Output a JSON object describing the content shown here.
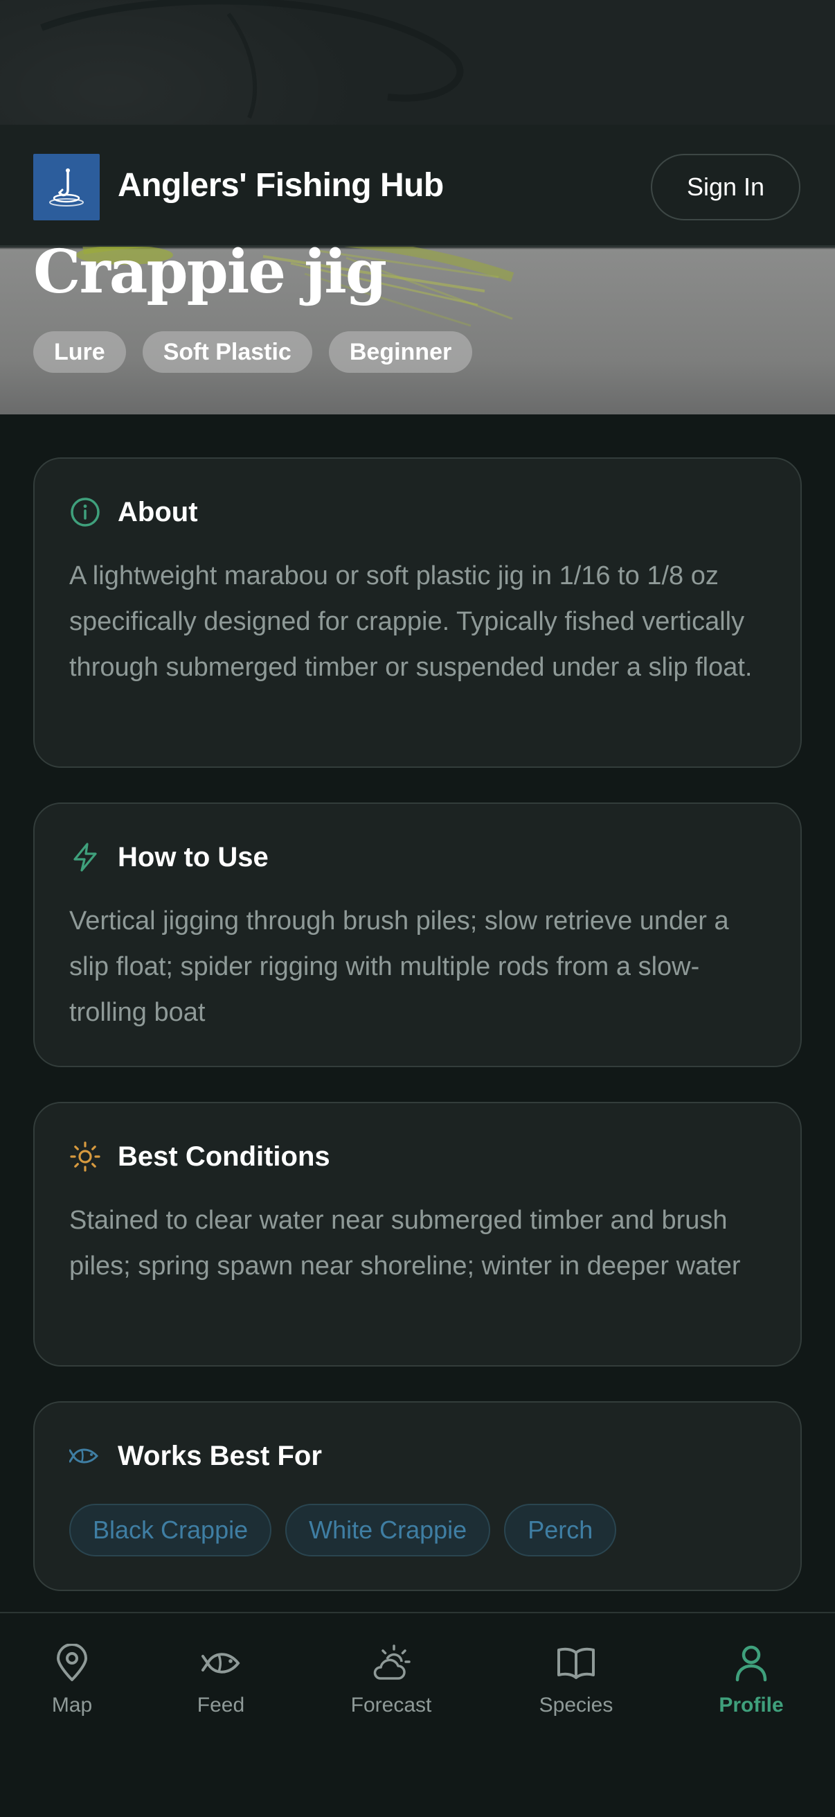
{
  "header": {
    "app_title": "Anglers' Fishing Hub",
    "logo_icon": "fishing-hook-icon",
    "sign_in_label": "Sign In"
  },
  "hero": {
    "title": "Crappie jig",
    "tags": [
      "Lure",
      "Soft Plastic",
      "Beginner"
    ]
  },
  "sections": {
    "about": {
      "icon": "info-icon",
      "title": "About",
      "body": "A lightweight marabou or soft plastic jig in 1/16 to 1/8 oz specifically designed for crappie. Typically fished vertically through submerged timber or suspended under a slip float."
    },
    "how_to_use": {
      "icon": "lightning-icon",
      "title": "How to Use",
      "body": "Vertical jigging through brush piles; slow retrieve under a slip float; spider rigging with multiple rods from a slow-trolling boat"
    },
    "best_conditions": {
      "icon": "sun-icon",
      "title": "Best Conditions",
      "body": "Stained to clear water near submerged timber and brush piles; spring spawn near shoreline; winter in deeper water"
    },
    "works_best_for": {
      "icon": "fish-icon",
      "title": "Works Best For",
      "species": [
        "Black Crappie",
        "White Crappie",
        "Perch"
      ]
    }
  },
  "bottom_nav": {
    "items": [
      {
        "label": "Map",
        "icon": "map-pin-icon"
      },
      {
        "label": "Feed",
        "icon": "fish-icon"
      },
      {
        "label": "Forecast",
        "icon": "weather-icon"
      },
      {
        "label": "Species",
        "icon": "book-icon"
      },
      {
        "label": "Profile",
        "icon": "user-icon"
      }
    ],
    "active": "Profile"
  },
  "colors": {
    "accent_green": "#3fa07c",
    "accent_blue": "#3f7ea3",
    "sun_orange": "#d79a3f",
    "logo_blue": "#2c5d9c"
  }
}
